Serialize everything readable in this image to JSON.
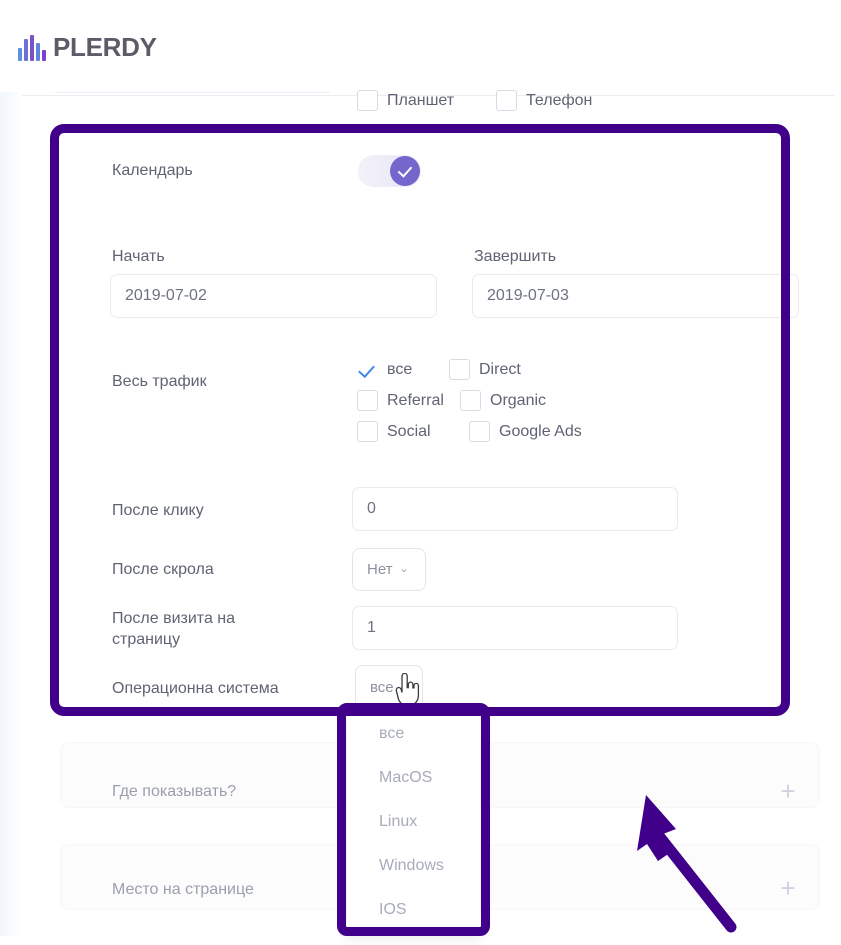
{
  "brand": {
    "name": "PLERDY",
    "accent": "#7a52c8"
  },
  "highlight": {
    "color": "#400089"
  },
  "device_filters": [
    {
      "label": "Планшет",
      "checked": false
    },
    {
      "label": "Телефон",
      "checked": false
    }
  ],
  "form": {
    "calendar": {
      "label": "Календарь",
      "enabled": true
    },
    "date_start": {
      "label": "Начать",
      "value": "2019-07-02"
    },
    "date_end": {
      "label": "Завершить",
      "value": "2019-07-03"
    },
    "traffic": {
      "label": "Весь трафик",
      "options": [
        {
          "label": "все",
          "checked": true
        },
        {
          "label": "Direct",
          "checked": false
        },
        {
          "label": "Referral",
          "checked": false
        },
        {
          "label": "Organic",
          "checked": false
        },
        {
          "label": "Social",
          "checked": false
        },
        {
          "label": "Google Ads",
          "checked": false
        }
      ]
    },
    "after_click": {
      "label": "После клику",
      "value": "0"
    },
    "after_scroll": {
      "label": "После скрола",
      "value": "Нет",
      "caret": "⌄"
    },
    "after_visit": {
      "label": "После визита на\nстраницу",
      "label_line1": "После визита на",
      "label_line2": "страницу",
      "value": "1"
    },
    "operating_system": {
      "label": "Операционна система",
      "value": "все",
      "open": true,
      "options": [
        "все",
        "MacOS",
        "Linux",
        "Windows",
        "IOS"
      ]
    }
  },
  "sections": [
    {
      "label": "Где показывать?",
      "action": "+"
    },
    {
      "label": "Место на странице",
      "action": "+"
    }
  ]
}
